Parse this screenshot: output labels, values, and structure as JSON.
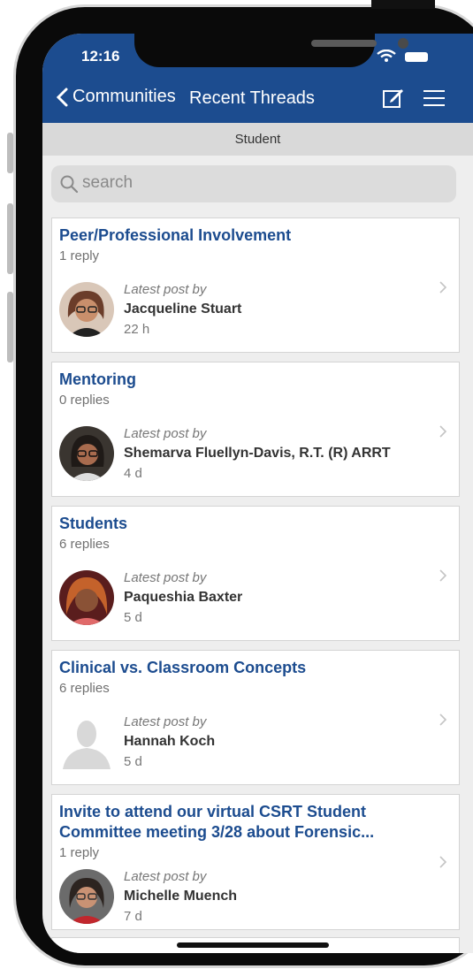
{
  "status": {
    "time": "12:16"
  },
  "nav": {
    "back_label": "Communities",
    "title": "Recent Threads"
  },
  "section": {
    "label": "Student"
  },
  "search": {
    "placeholder": "search"
  },
  "threads": [
    {
      "title": "Peer/Professional Involvement",
      "replies": "1 reply",
      "latest_label": "Latest post by",
      "author": "Jacqueline Stuart",
      "age": "22 h"
    },
    {
      "title": "Mentoring",
      "replies": "0 replies",
      "latest_label": "Latest post by",
      "author": "Shemarva Fluellyn-Davis, R.T. (R) ARRT",
      "age": "4 d"
    },
    {
      "title": "Students",
      "replies": "6 replies",
      "latest_label": "Latest post by",
      "author": "Paqueshia Baxter",
      "age": "5 d"
    },
    {
      "title": "Clinical vs. Classroom Concepts",
      "replies": "6 replies",
      "latest_label": "Latest post by",
      "author": "Hannah Koch",
      "age": "5 d"
    },
    {
      "title": "Invite to attend our virtual CSRT Student Committee meeting 3/28 about Forensic...",
      "replies": "1 reply",
      "latest_label": "Latest post by",
      "author": "Michelle Muench",
      "age": "7 d"
    }
  ],
  "colors": {
    "brand": "#1c4c8f",
    "title": "#1c4c8f",
    "background": "#eeeeee"
  }
}
